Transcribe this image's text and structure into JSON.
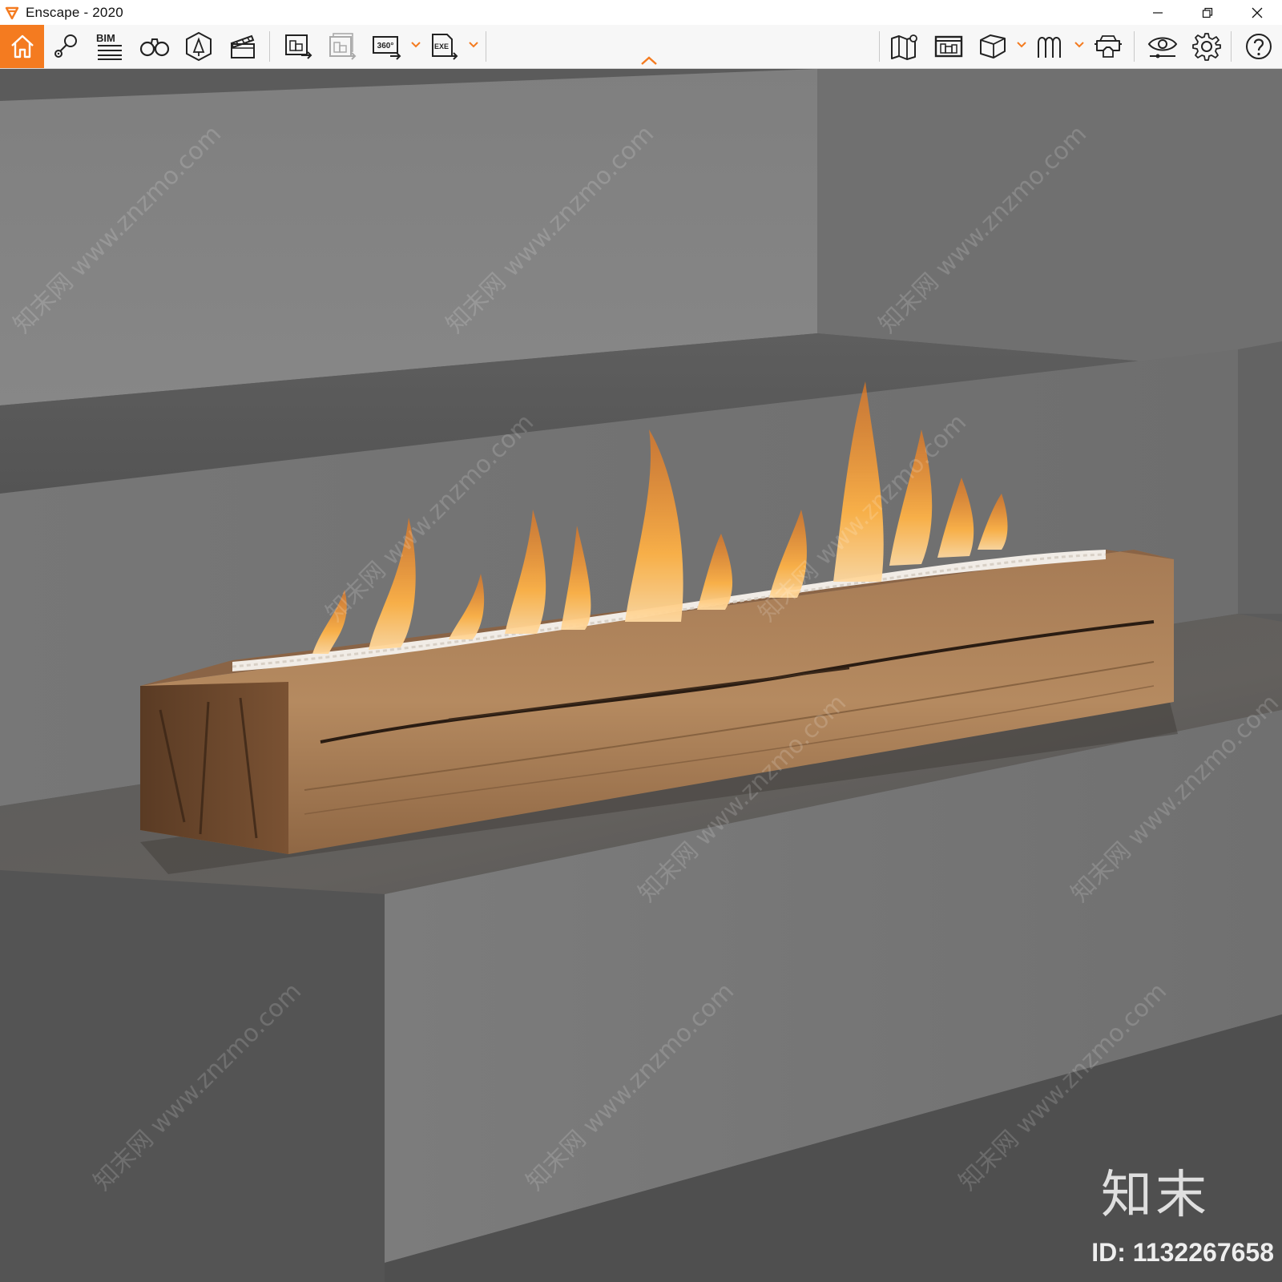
{
  "window": {
    "title": "Enscape - 2020",
    "controls": {
      "minimize": "minimize-icon",
      "restore": "restore-icon",
      "close": "close-icon"
    }
  },
  "toolbar": {
    "accent_color": "#f47b20",
    "left_group": [
      {
        "id": "home",
        "icon": "home-icon",
        "active": true
      },
      {
        "id": "views",
        "icon": "location-pin-icon"
      },
      {
        "id": "bim",
        "icon": "bim-list-icon",
        "label": "BIM"
      },
      {
        "id": "walk-mode",
        "icon": "binoculars-icon"
      },
      {
        "id": "asset-library",
        "icon": "asset-library-icon"
      },
      {
        "id": "video-editor",
        "icon": "clapperboard-icon"
      }
    ],
    "export_group": [
      {
        "id": "render-image",
        "icon": "render-image-icon"
      },
      {
        "id": "batch-render",
        "icon": "batch-render-icon",
        "disabled": true
      },
      {
        "id": "panorama",
        "icon": "panorama-360-icon",
        "label": "360°",
        "has_dropdown": true
      },
      {
        "id": "export-exe",
        "icon": "export-exe-icon",
        "label": "EXE",
        "has_dropdown": true
      }
    ],
    "right_group": [
      {
        "id": "map",
        "icon": "map-icon"
      },
      {
        "id": "web-standalone",
        "icon": "web-standalone-icon"
      },
      {
        "id": "view-mode",
        "icon": "cube-icon",
        "has_dropdown": true
      },
      {
        "id": "material-editor",
        "icon": "material-editor-icon",
        "has_dropdown": true
      },
      {
        "id": "vr-headset",
        "icon": "vr-headset-icon"
      },
      {
        "id": "visual-settings",
        "icon": "eye-settings-icon"
      },
      {
        "id": "general-settings",
        "icon": "gear-icon"
      },
      {
        "id": "help",
        "icon": "help-icon"
      }
    ],
    "collapse_toggle": "chevron-up-icon"
  },
  "viewport": {
    "scene": "wooden-beam-fireplace-on-gray-steps",
    "watermark_text": "知末网 www.znzmo.com",
    "brand_text": "知末",
    "image_id_text": "ID: 1132267658"
  }
}
